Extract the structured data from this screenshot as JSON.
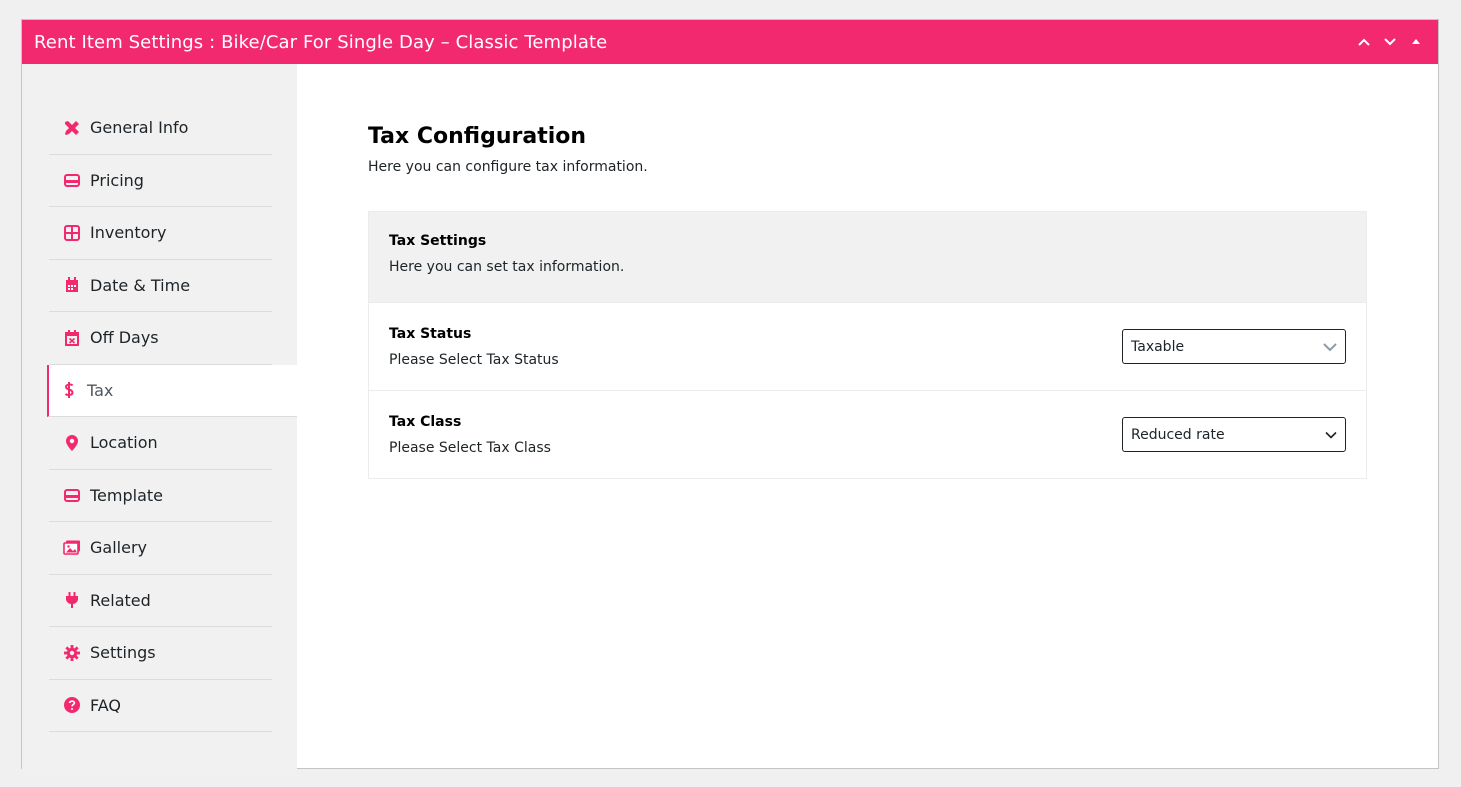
{
  "header": {
    "title": "Rent Item Settings : Bike/Car For Single Day – Classic Template",
    "bg_color": "#f3296f"
  },
  "sidebar": {
    "items": [
      {
        "label": "General Info",
        "icon": "tools-icon"
      },
      {
        "label": "Pricing",
        "icon": "card-icon"
      },
      {
        "label": "Inventory",
        "icon": "grid-icon"
      },
      {
        "label": "Date & Time",
        "icon": "calendar-icon"
      },
      {
        "label": "Off Days",
        "icon": "calendar-x-icon"
      },
      {
        "label": "Tax",
        "icon": "dollar-icon",
        "active": true
      },
      {
        "label": "Location",
        "icon": "map-pin-icon"
      },
      {
        "label": "Template",
        "icon": "card-icon"
      },
      {
        "label": "Gallery",
        "icon": "images-icon"
      },
      {
        "label": "Related",
        "icon": "plug-icon"
      },
      {
        "label": "Settings",
        "icon": "gear-icon"
      },
      {
        "label": "FAQ",
        "icon": "question-icon"
      }
    ]
  },
  "main": {
    "title": "Tax Configuration",
    "subtitle": "Here you can configure tax information.",
    "section": {
      "title": "Tax Settings",
      "desc": "Here you can set tax information."
    },
    "fields": [
      {
        "label": "Tax Status",
        "desc": "Please Select Tax Status",
        "value": "Taxable"
      },
      {
        "label": "Tax Class",
        "desc": "Please Select Tax Class",
        "value": "Reduced rate"
      }
    ]
  },
  "accent_color": "#f3296f"
}
